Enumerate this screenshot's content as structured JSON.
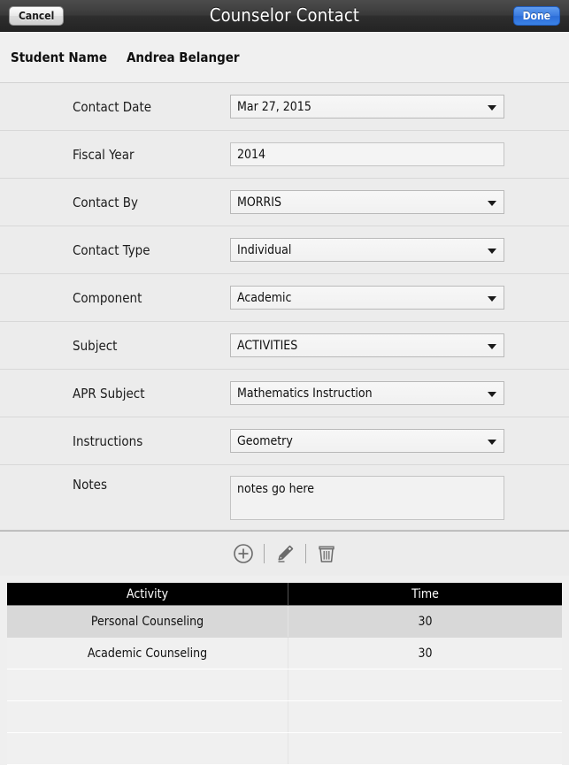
{
  "navbar": {
    "cancel_label": "Cancel",
    "title": "Counselor Contact",
    "done_label": "Done"
  },
  "student_header": {
    "label": "Student Name",
    "value": "Andrea Belanger"
  },
  "form": {
    "rows": [
      {
        "label": "Contact Date",
        "type": "select",
        "value": "Mar 27, 2015"
      },
      {
        "label": "Fiscal Year",
        "type": "text",
        "value": "2014"
      },
      {
        "label": "Contact By",
        "type": "select",
        "value": "MORRIS"
      },
      {
        "label": "Contact Type",
        "type": "select",
        "value": "Individual"
      },
      {
        "label": "Component",
        "type": "select",
        "value": "Academic"
      },
      {
        "label": "Subject",
        "type": "select",
        "value": "ACTIVITIES"
      },
      {
        "label": "APR Subject",
        "type": "select",
        "value": "Mathematics Instruction"
      },
      {
        "label": "Instructions",
        "type": "select",
        "value": "Geometry"
      },
      {
        "label": "Notes",
        "type": "textarea",
        "value": "notes go here"
      }
    ]
  },
  "toolbar": {
    "buttons": [
      {
        "name": "add-icon",
        "label": "Add"
      },
      {
        "name": "edit-icon",
        "label": "Edit"
      },
      {
        "name": "delete-icon",
        "label": "Delete"
      }
    ]
  },
  "activity_table": {
    "columns": [
      "Activity",
      "Time"
    ],
    "rows": [
      {
        "activity": "Personal Counseling",
        "time": "30",
        "selected": true
      },
      {
        "activity": "Academic Counseling",
        "time": "30",
        "selected": false
      }
    ],
    "empty_row_count": 3
  },
  "colors": {
    "accent": "#3c7ce0",
    "page_bg": "#ececec",
    "header_bg": "#000000"
  }
}
